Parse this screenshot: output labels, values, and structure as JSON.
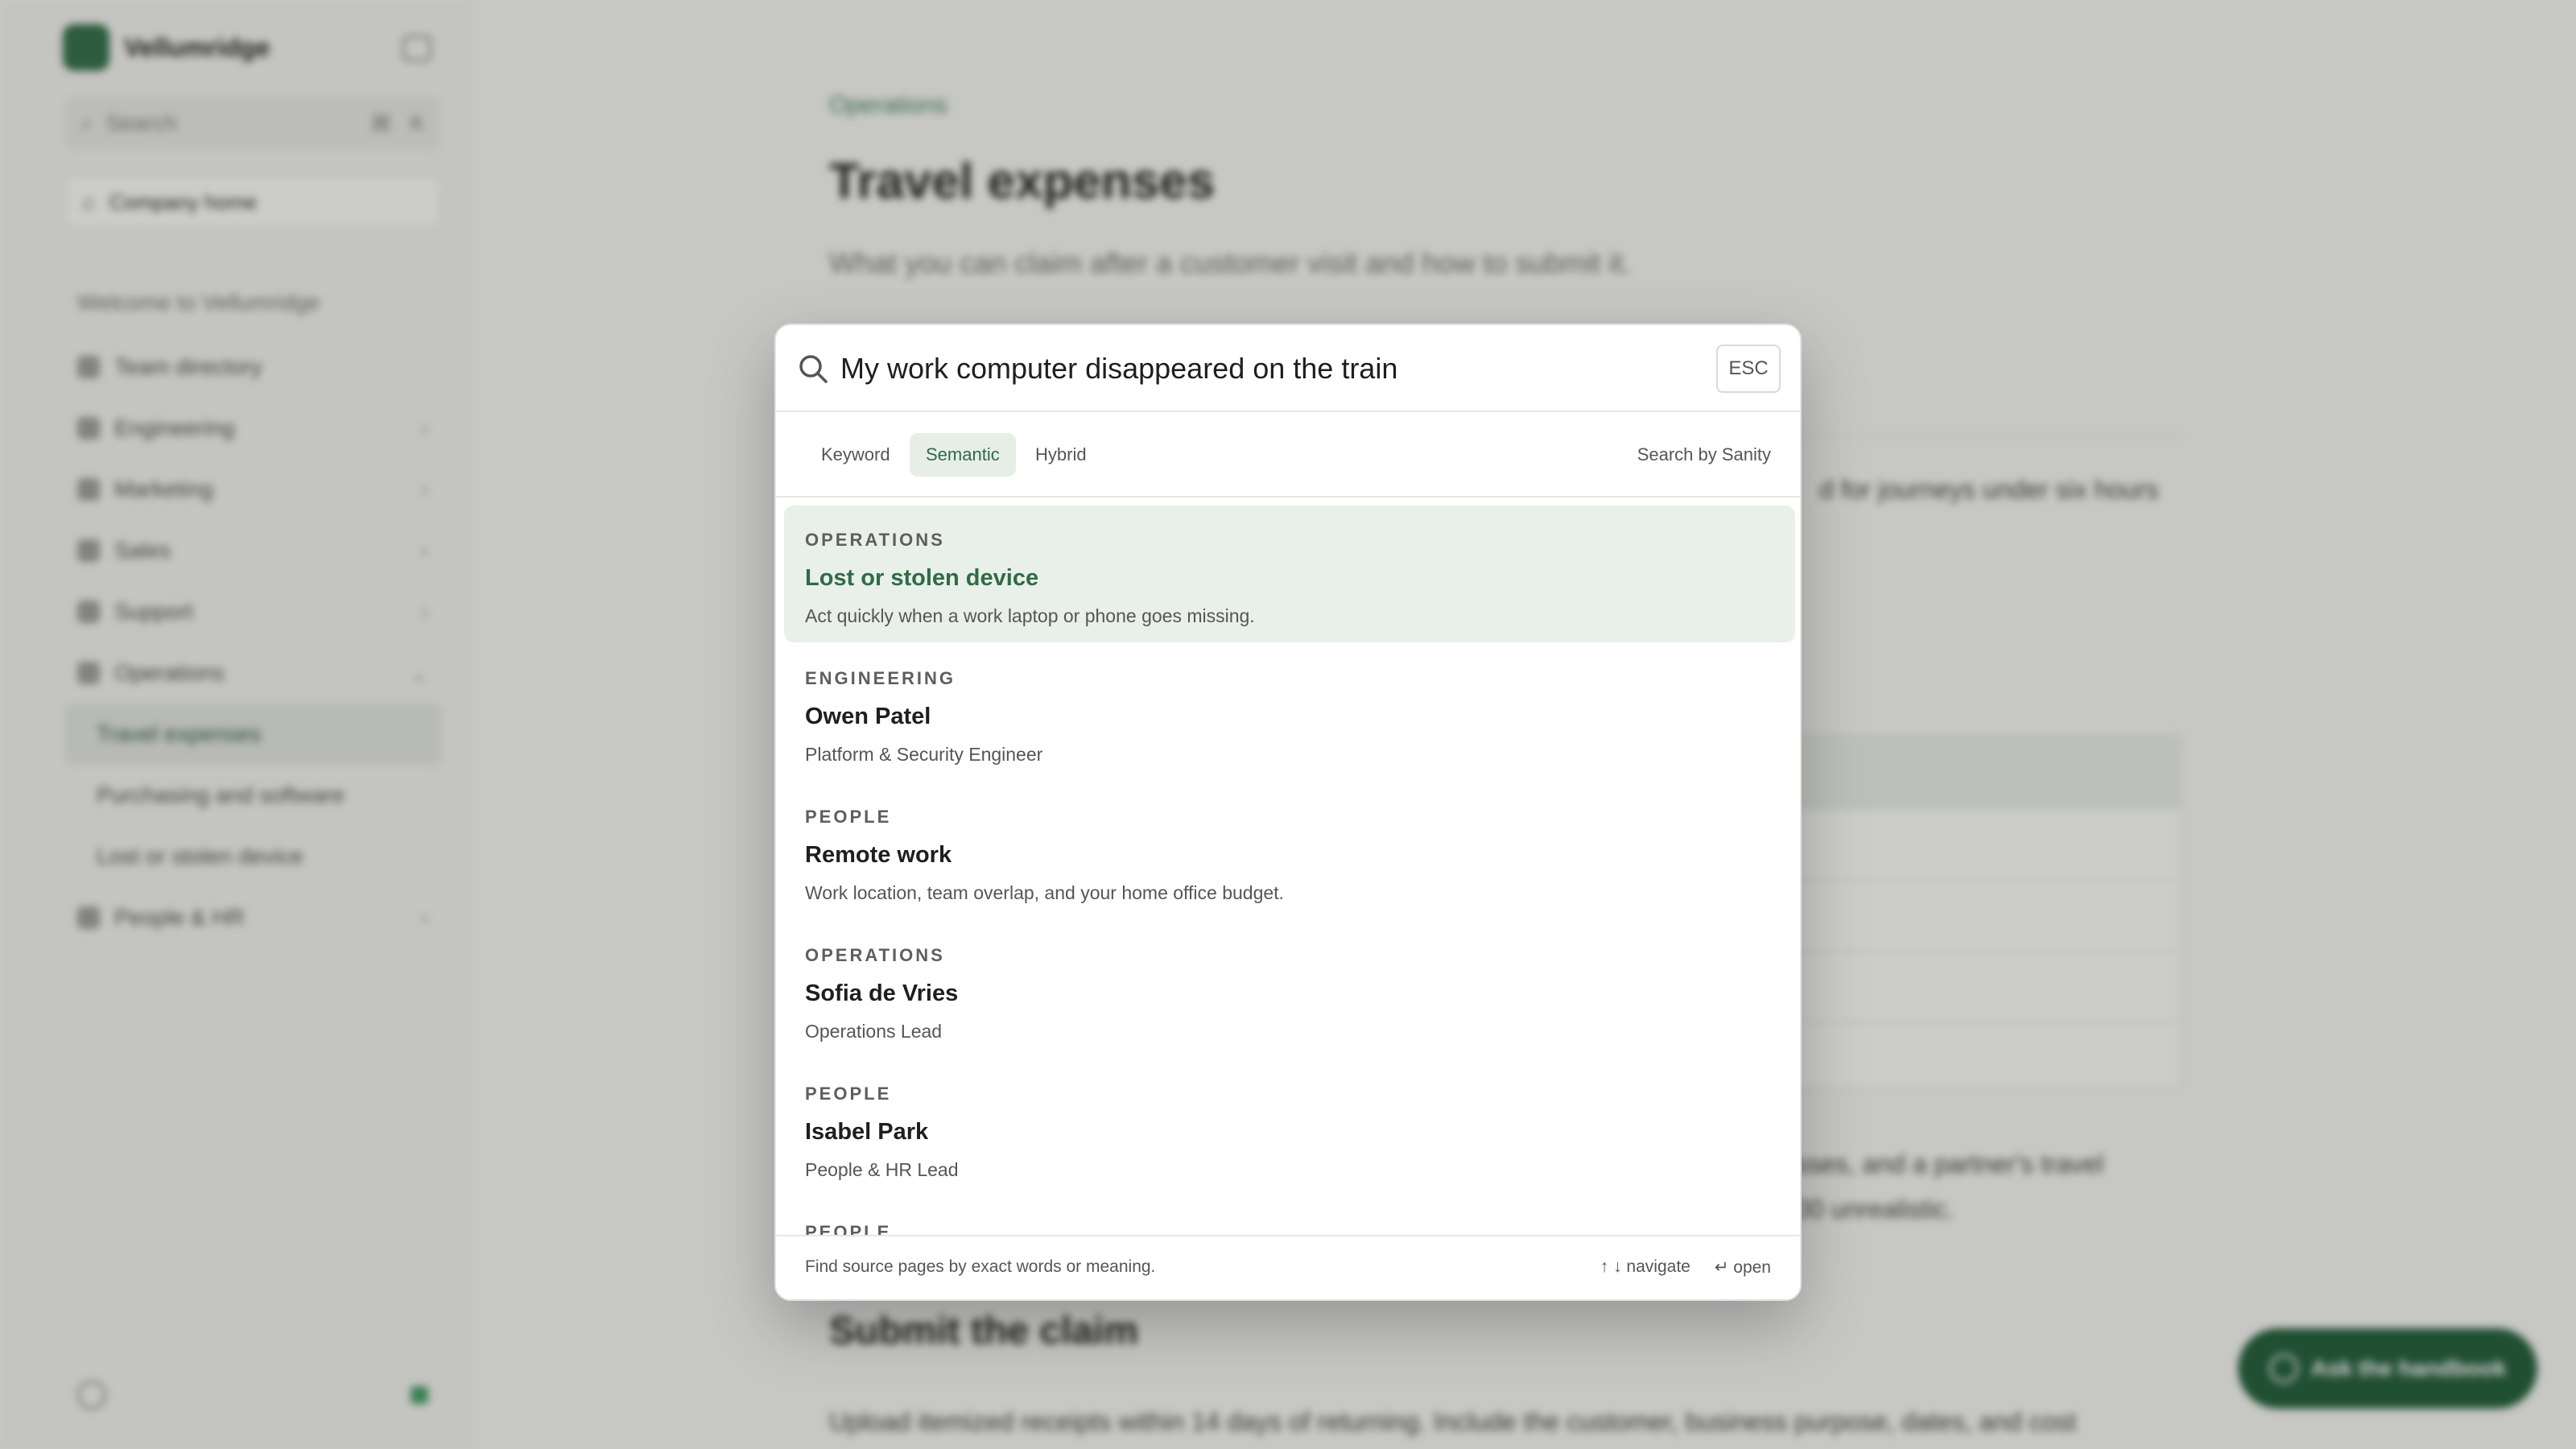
{
  "app": {
    "brand_name": "Vellumridge",
    "search_label": "Search",
    "search_shortcut": [
      "⌘",
      "K"
    ],
    "home_label": "Company home"
  },
  "sidebar": {
    "section": "Welcome to Vellumridge",
    "items": [
      {
        "label": "Team directory",
        "chevron": ""
      },
      {
        "label": "Engineering",
        "chevron": "›"
      },
      {
        "label": "Marketing",
        "chevron": "›"
      },
      {
        "label": "Sales",
        "chevron": "›"
      },
      {
        "label": "Support",
        "chevron": "›"
      },
      {
        "label": "Operations",
        "chevron": "⌄"
      },
      {
        "label": "Travel expenses",
        "chevron": ""
      },
      {
        "label": "Purchasing and software",
        "chevron": ""
      },
      {
        "label": "Lost or stolen device",
        "chevron": ""
      },
      {
        "label": "People & HR",
        "chevron": "›"
      }
    ]
  },
  "page": {
    "breadcrumb": "Operations",
    "title": "Travel expenses",
    "lede": "What you can claim after a customer visit and how to submit it.",
    "para_fragment_1": "d for journeys under six hours",
    "para_fragment_2": "sses, and a partner's travel",
    "para_fragment_3": "00 unrealistic.",
    "section_heading": "Submit the claim",
    "section_body": "Upload itemized receipts within 14 days of returning. Include the customer, business purpose, dates, and cost",
    "ask_button": "Ask the handbook"
  },
  "modal": {
    "query": "My work computer disappeared on the train",
    "esc_label": "ESC",
    "tabs": [
      {
        "label": "Keyword",
        "active": false
      },
      {
        "label": "Semantic",
        "active": true
      },
      {
        "label": "Hybrid",
        "active": false
      }
    ],
    "powered_by": "Search by Sanity",
    "results": [
      {
        "category": "OPERATIONS",
        "title": "Lost or stolen device",
        "description": "Act quickly when a work laptop or phone goes missing."
      },
      {
        "category": "ENGINEERING",
        "title": "Owen Patel",
        "description": "Platform & Security Engineer"
      },
      {
        "category": "PEOPLE",
        "title": "Remote work",
        "description": "Work location, team overlap, and your home office budget."
      },
      {
        "category": "OPERATIONS",
        "title": "Sofia de Vries",
        "description": "Operations Lead"
      },
      {
        "category": "PEOPLE",
        "title": "Isabel Park",
        "description": "People & HR Lead"
      },
      {
        "category": "PEOPLE",
        "title": "",
        "description": ""
      }
    ],
    "footer_hint": "Find source pages by exact words or meaning.",
    "footer_navigate": "↑ ↓ navigate",
    "footer_open": "↵ open"
  },
  "colors": {
    "accent": "#2f6b47",
    "selected_bg": "#e9f0e9",
    "ask_button_bg": "#1f5a37"
  }
}
